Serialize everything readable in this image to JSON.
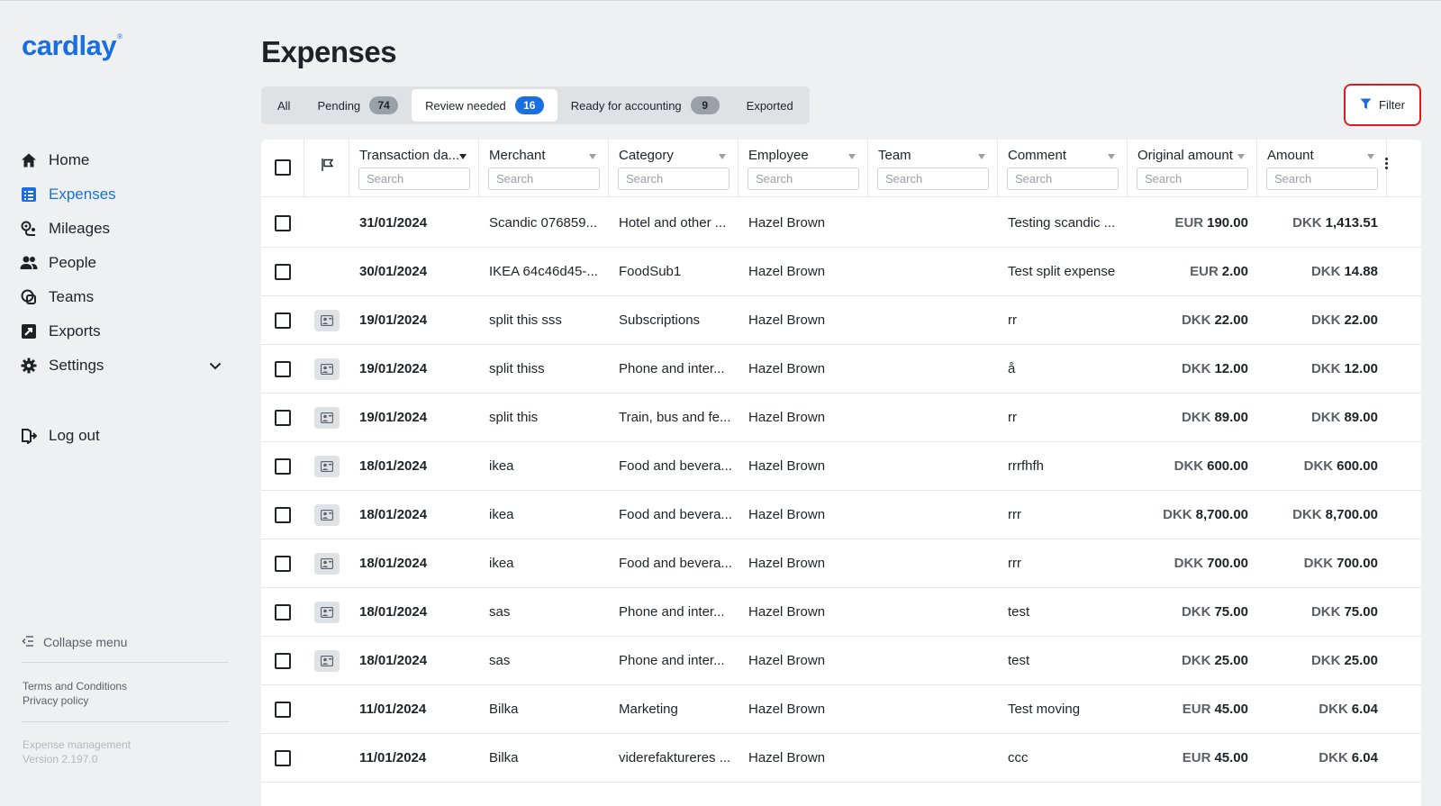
{
  "brand": {
    "name": "cardlay",
    "mark": "®"
  },
  "nav": {
    "items": [
      {
        "label": "Home",
        "icon": "home-icon",
        "active": false
      },
      {
        "label": "Expenses",
        "icon": "expenses-icon",
        "active": true
      },
      {
        "label": "Mileages",
        "icon": "mileages-icon",
        "active": false
      },
      {
        "label": "People",
        "icon": "people-icon",
        "active": false
      },
      {
        "label": "Teams",
        "icon": "teams-icon",
        "active": false
      },
      {
        "label": "Exports",
        "icon": "exports-icon",
        "active": false
      },
      {
        "label": "Settings",
        "icon": "gear-icon",
        "active": false
      }
    ],
    "logout": "Log out",
    "collapse": "Collapse menu",
    "terms": "Terms and Conditions",
    "privacy": "Privacy policy",
    "product": "Expense management",
    "version": "Version 2.197.0"
  },
  "page": {
    "title": "Expenses"
  },
  "tabs": [
    {
      "label": "All",
      "count": null
    },
    {
      "label": "Pending",
      "count": "74"
    },
    {
      "label": "Review needed",
      "count": "16"
    },
    {
      "label": "Ready for accounting",
      "count": "9"
    },
    {
      "label": "Exported",
      "count": null
    }
  ],
  "active_tab": "Review needed",
  "filter": {
    "label": "Filter"
  },
  "columns": {
    "date": "Transaction da...",
    "merchant": "Merchant",
    "category": "Category",
    "employee": "Employee",
    "team": "Team",
    "comment": "Comment",
    "original_amount": "Original amount",
    "amount": "Amount",
    "search_placeholder": "Search"
  },
  "rows": [
    {
      "date": "31/01/2024",
      "merchant": "Scandic 076859...",
      "category": "Hotel and other ...",
      "employee": "Hazel Brown",
      "team": "",
      "comment": "Testing scandic ...",
      "orig_cur": "EUR",
      "orig_amt": "190.00",
      "cur": "DKK",
      "amt": "1,413.51",
      "receipt": false
    },
    {
      "date": "30/01/2024",
      "merchant": "IKEA 64c46d45-...",
      "category": "FoodSub1",
      "employee": "Hazel Brown",
      "team": "",
      "comment": "Test split expense",
      "orig_cur": "EUR",
      "orig_amt": "2.00",
      "cur": "DKK",
      "amt": "14.88",
      "receipt": false
    },
    {
      "date": "19/01/2024",
      "merchant": "split this sss",
      "category": "Subscriptions",
      "employee": "Hazel Brown",
      "team": "",
      "comment": "rr",
      "orig_cur": "DKK",
      "orig_amt": "22.00",
      "cur": "DKK",
      "amt": "22.00",
      "receipt": true
    },
    {
      "date": "19/01/2024",
      "merchant": "split thiss",
      "category": "Phone and inter...",
      "employee": "Hazel Brown",
      "team": "",
      "comment": "å",
      "orig_cur": "DKK",
      "orig_amt": "12.00",
      "cur": "DKK",
      "amt": "12.00",
      "receipt": true
    },
    {
      "date": "19/01/2024",
      "merchant": "split this",
      "category": "Train, bus and fe...",
      "employee": "Hazel Brown",
      "team": "",
      "comment": "rr",
      "orig_cur": "DKK",
      "orig_amt": "89.00",
      "cur": "DKK",
      "amt": "89.00",
      "receipt": true
    },
    {
      "date": "18/01/2024",
      "merchant": "ikea",
      "category": "Food and bevera...",
      "employee": "Hazel Brown",
      "team": "",
      "comment": "rrrfhfh",
      "orig_cur": "DKK",
      "orig_amt": "600.00",
      "cur": "DKK",
      "amt": "600.00",
      "receipt": true
    },
    {
      "date": "18/01/2024",
      "merchant": "ikea",
      "category": "Food and bevera...",
      "employee": "Hazel Brown",
      "team": "",
      "comment": "rrr",
      "orig_cur": "DKK",
      "orig_amt": "8,700.00",
      "cur": "DKK",
      "amt": "8,700.00",
      "receipt": true
    },
    {
      "date": "18/01/2024",
      "merchant": "ikea",
      "category": "Food and bevera...",
      "employee": "Hazel Brown",
      "team": "",
      "comment": "rrr",
      "orig_cur": "DKK",
      "orig_amt": "700.00",
      "cur": "DKK",
      "amt": "700.00",
      "receipt": true
    },
    {
      "date": "18/01/2024",
      "merchant": "sas",
      "category": "Phone and inter...",
      "employee": "Hazel Brown",
      "team": "",
      "comment": "test",
      "orig_cur": "DKK",
      "orig_amt": "75.00",
      "cur": "DKK",
      "amt": "75.00",
      "receipt": true
    },
    {
      "date": "18/01/2024",
      "merchant": "sas",
      "category": "Phone and inter...",
      "employee": "Hazel Brown",
      "team": "",
      "comment": "test",
      "orig_cur": "DKK",
      "orig_amt": "25.00",
      "cur": "DKK",
      "amt": "25.00",
      "receipt": true
    },
    {
      "date": "11/01/2024",
      "merchant": "Bilka",
      "category": "Marketing",
      "employee": "Hazel Brown",
      "team": "",
      "comment": "Test moving",
      "orig_cur": "EUR",
      "orig_amt": "45.00",
      "cur": "DKK",
      "amt": "6.04",
      "receipt": false
    },
    {
      "date": "11/01/2024",
      "merchant": "Bilka",
      "category": "viderefaktureres ...",
      "employee": "Hazel Brown",
      "team": "",
      "comment": "ccc",
      "orig_cur": "EUR",
      "orig_amt": "45.00",
      "cur": "DKK",
      "amt": "6.04",
      "receipt": false
    }
  ],
  "colors": {
    "accent": "#1a6fe0",
    "highlight": "#e01b1b",
    "background": "#eef0f2"
  }
}
